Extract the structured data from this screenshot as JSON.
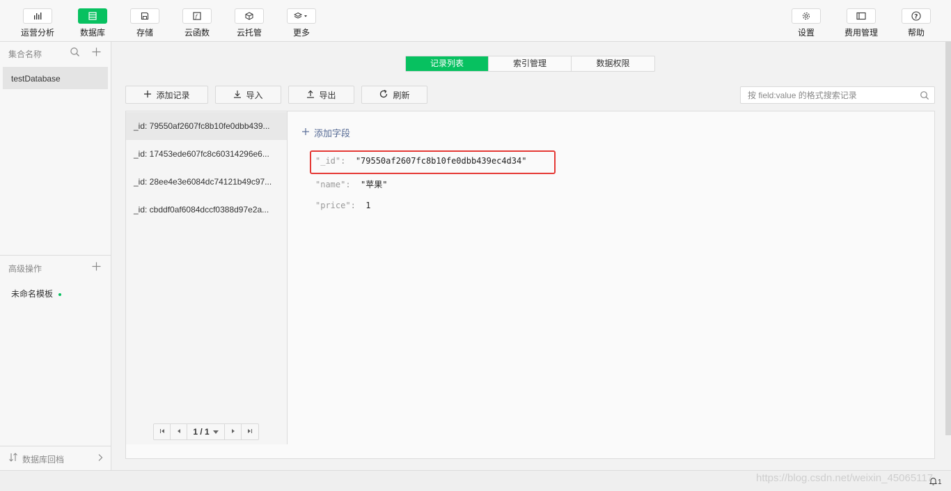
{
  "toolbar": {
    "left_tools": [
      {
        "label": "运营分析",
        "icon": "bar-chart-icon"
      },
      {
        "label": "数据库",
        "icon": "database-icon",
        "active": true
      },
      {
        "label": "存储",
        "icon": "storage-icon"
      },
      {
        "label": "云函数",
        "icon": "function-icon"
      },
      {
        "label": "云托管",
        "icon": "cube-icon"
      },
      {
        "label": "更多",
        "icon": "layers-icon"
      }
    ],
    "right_tools": [
      {
        "label": "设置",
        "icon": "gear-icon"
      },
      {
        "label": "费用管理",
        "icon": "billing-icon"
      },
      {
        "label": "帮助",
        "icon": "help-icon"
      }
    ]
  },
  "sidebar": {
    "collection_header": "集合名称",
    "collections": [
      "testDatabase"
    ],
    "advanced_header": "高级操作",
    "templates": [
      "未命名模板"
    ],
    "rollback_label": "数据库回档"
  },
  "tabs": [
    "记录列表",
    "索引管理",
    "数据权限"
  ],
  "active_tab": "记录列表",
  "actions": {
    "add_record": "添加记录",
    "import": "导入",
    "export": "导出",
    "refresh": "刷新"
  },
  "search": {
    "placeholder": "按 field:value 的格式搜索记录"
  },
  "records": [
    "_id: 79550af2607fc8b10fe0dbb439...",
    "_id: 17453ede607fc8c60314296e6...",
    "_id: 28ee4e3e6084dc74121b49c97...",
    "_id: cbddf0af6084dccf0388d97e2a..."
  ],
  "pagination": {
    "page_label": "1 / 1"
  },
  "detail": {
    "add_field_label": "添加字段",
    "fields": [
      {
        "key": "\"_id\"",
        "value": "\"79550af2607fc8b10fe0dbb439ec4d34\""
      },
      {
        "key": "\"name\"",
        "value": "\"苹果\""
      },
      {
        "key": "\"price\"",
        "value": "1"
      }
    ]
  },
  "status": {
    "notification_count": "1",
    "watermark": "https://blog.csdn.net/weixin_45065117"
  },
  "colors": {
    "accent": "#07c160",
    "highlight": "#e53935",
    "link": "#576b95"
  }
}
